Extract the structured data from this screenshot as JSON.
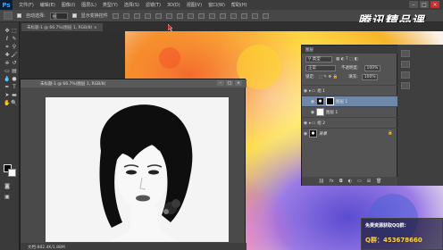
{
  "app": {
    "logo": "Ps",
    "menu": [
      "文件(F)",
      "编辑(E)",
      "图像(I)",
      "图层(L)",
      "类型(Y)",
      "选择(S)",
      "滤镜(T)",
      "3D(D)",
      "视图(V)",
      "窗口(W)",
      "帮助(H)"
    ]
  },
  "options_bar": {
    "label_1": "自动选择:",
    "field_1": "组",
    "label_2": "显示变换控件"
  },
  "brand": "腾讯精品课",
  "tabs": [
    {
      "label": "未标题-1 @ 66.7%(图层 1, RGB/8) ×"
    }
  ],
  "document_window": {
    "title": "未标题-1 @ 66.7%(图层 1, RGB/8)",
    "status": "文档:882.4K/1.88M"
  },
  "layers_panel": {
    "title": "图层",
    "blend_mode": "正常",
    "opacity_label": "不透明度:",
    "opacity_value": "100%",
    "lock_label": "锁定:",
    "fill_label": "填充:",
    "fill_value": "100%",
    "layers": [
      {
        "name": "组 1",
        "type": "group",
        "selected": false
      },
      {
        "name": "图层 1",
        "type": "masked",
        "selected": true
      },
      {
        "name": "图层 1",
        "type": "white",
        "selected": false
      },
      {
        "name": "组 2",
        "type": "group",
        "selected": false
      },
      {
        "name": "背景",
        "type": "face",
        "selected": false
      }
    ]
  },
  "promo": {
    "line1": "免费资源获取QQ群：",
    "line2": "Q群：453678660"
  },
  "colors": {
    "accent_selected_layer": "#6f87a8",
    "brand_text": "#ffffff",
    "promo_number": "#ffd23a"
  }
}
